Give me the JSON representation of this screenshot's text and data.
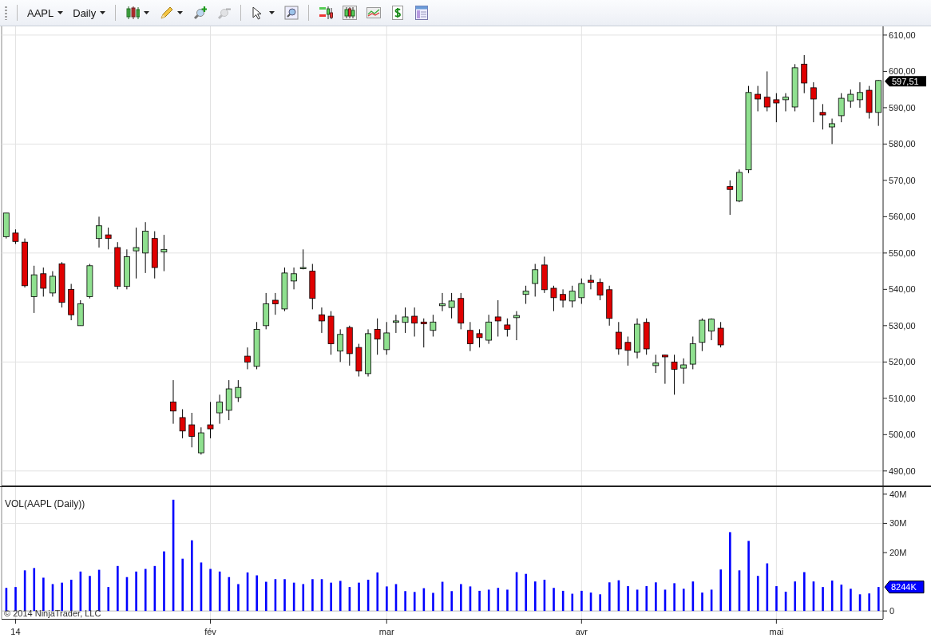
{
  "toolbar": {
    "instrument": "AAPL",
    "interval": "Daily",
    "tools": [
      {
        "kind": "bars",
        "disabled": false
      },
      {
        "kind": "pencil",
        "disabled": false
      },
      {
        "kind": "zoom-in",
        "disabled": false
      },
      {
        "kind": "zoom-out",
        "disabled": true
      },
      {
        "kind": "pointer",
        "disabled": false
      },
      {
        "kind": "zoom-box",
        "disabled": false
      },
      {
        "kind": "indicators",
        "disabled": false
      },
      {
        "kind": "strategy",
        "disabled": false
      },
      {
        "kind": "lines",
        "disabled": false
      },
      {
        "kind": "dollar",
        "disabled": false
      },
      {
        "kind": "properties",
        "disabled": false
      }
    ]
  },
  "price_pane": {
    "last_price_tag": "597,51",
    "chart_data": {
      "type": "candlestick",
      "grid": true,
      "ylim": [
        486,
        612.4
      ],
      "yticks": [
        {
          "value": 490,
          "label": "490,00"
        },
        {
          "value": 500,
          "label": "500,00"
        },
        {
          "value": 510,
          "label": "510,00"
        },
        {
          "value": 520,
          "label": "520,00"
        },
        {
          "value": 530,
          "label": "530,00"
        },
        {
          "value": 540,
          "label": "540,00"
        },
        {
          "value": 550,
          "label": "550,00"
        },
        {
          "value": 560,
          "label": "560,00"
        },
        {
          "value": 570,
          "label": "570,00"
        },
        {
          "value": 580,
          "label": "580,00"
        },
        {
          "value": 590,
          "label": "590,00"
        },
        {
          "value": 600,
          "label": "600,00"
        },
        {
          "value": 610,
          "label": "610,00"
        }
      ],
      "categories": [
        null,
        null,
        null,
        null,
        null,
        null,
        null,
        null,
        null,
        null,
        null,
        null,
        null,
        null,
        null,
        null,
        null,
        null,
        null,
        null,
        null,
        null,
        null,
        null,
        null,
        null,
        null,
        null,
        null,
        null,
        null,
        null,
        null,
        null,
        null,
        null,
        null,
        null,
        null,
        null,
        null,
        null,
        null,
        null,
        null,
        null,
        null,
        null,
        null,
        null,
        null,
        null,
        null,
        null,
        null,
        null,
        null,
        null,
        null,
        null,
        null,
        null,
        null,
        null,
        null,
        null,
        null,
        null,
        null,
        null,
        null,
        null,
        null,
        null,
        null,
        null,
        null,
        null,
        null,
        null,
        null,
        null,
        null,
        null,
        null,
        null,
        null,
        null,
        null,
        null,
        null,
        null,
        null,
        null,
        null
      ],
      "ohlc": [
        [
          554.5,
          561,
          554,
          561
        ],
        [
          555.5,
          556.5,
          552.5,
          553.2
        ],
        [
          553,
          554,
          540.5,
          541
        ],
        [
          538,
          546.5,
          533.5,
          544
        ],
        [
          544.3,
          546,
          538,
          540.3
        ],
        [
          539,
          545,
          538,
          543.6
        ],
        [
          547,
          547.5,
          535,
          536.4
        ],
        [
          540,
          541.5,
          531.5,
          533
        ],
        [
          530,
          537,
          530,
          536
        ],
        [
          538,
          547,
          537.5,
          546.5
        ],
        [
          554,
          560,
          551.5,
          557.5
        ],
        [
          555,
          557,
          551,
          554
        ],
        [
          551.5,
          553,
          540,
          540.8
        ],
        [
          540.8,
          551,
          540,
          549
        ],
        [
          550.6,
          557,
          543,
          551.5
        ],
        [
          550,
          558.5,
          544.5,
          556
        ],
        [
          554,
          556,
          543,
          546
        ],
        [
          550.3,
          555,
          545,
          551
        ],
        [
          509,
          515,
          503,
          506.5
        ],
        [
          504.7,
          507,
          499,
          501
        ],
        [
          502.7,
          506,
          496.5,
          499.5
        ],
        [
          495,
          502,
          494.5,
          500.5
        ],
        [
          502.7,
          509,
          499,
          501.6
        ],
        [
          506,
          511,
          503,
          509
        ],
        [
          506.7,
          515,
          504,
          512.6
        ],
        [
          510.2,
          515,
          509,
          513
        ],
        [
          521.6,
          524,
          518,
          520
        ],
        [
          518.8,
          531,
          518,
          529
        ],
        [
          530,
          539,
          529,
          536
        ],
        [
          537,
          539,
          533,
          536
        ],
        [
          534.6,
          546,
          534,
          544.5
        ],
        [
          542.3,
          546,
          540,
          544.3
        ],
        [
          545.8,
          551,
          545.5,
          546
        ],
        [
          545,
          547,
          534.5,
          537.5
        ],
        [
          533,
          535,
          528,
          531.3
        ],
        [
          532.6,
          534,
          522,
          525
        ],
        [
          523,
          529,
          520,
          527.6
        ],
        [
          529.5,
          530,
          519,
          522.3
        ],
        [
          524,
          525,
          516,
          517.5
        ],
        [
          516.8,
          529,
          516,
          527.8
        ],
        [
          529,
          532,
          522,
          526.3
        ],
        [
          523.4,
          531,
          522,
          528
        ],
        [
          530.9,
          533,
          528,
          531.3
        ],
        [
          530.9,
          535,
          528,
          532.4
        ],
        [
          532.6,
          535,
          527,
          530.7
        ],
        [
          531,
          532,
          524,
          530.5
        ],
        [
          528.7,
          533,
          527,
          531
        ],
        [
          535.5,
          539,
          534,
          536
        ],
        [
          535,
          539,
          532,
          536.8
        ],
        [
          537.5,
          539,
          529,
          530.7
        ],
        [
          528.7,
          531,
          523,
          525
        ],
        [
          527.8,
          529,
          524,
          526.7
        ],
        [
          526,
          533,
          525,
          531
        ],
        [
          532.4,
          537,
          527,
          531.3
        ],
        [
          530.2,
          532,
          527,
          529
        ],
        [
          532.2,
          534,
          526,
          532.8
        ],
        [
          538.6,
          541,
          536,
          539.5
        ],
        [
          541.6,
          547,
          538,
          545.4
        ],
        [
          546.7,
          549,
          539,
          539.9
        ],
        [
          540.3,
          541,
          534,
          537.7
        ],
        [
          538.6,
          540,
          535,
          537
        ],
        [
          536.8,
          541,
          535,
          539.5
        ],
        [
          537.7,
          543,
          536,
          541.6
        ],
        [
          542.5,
          544,
          540,
          541.9
        ],
        [
          541.9,
          543,
          537,
          538.4
        ],
        [
          539.9,
          541,
          530,
          532
        ],
        [
          528.2,
          531,
          522,
          523.6
        ],
        [
          525.4,
          527,
          519,
          523.2
        ],
        [
          522.7,
          532,
          521,
          530.4
        ],
        [
          530.9,
          532,
          522,
          523.6
        ],
        [
          519,
          522,
          517,
          519.7
        ],
        [
          521.9,
          522,
          514,
          521.4
        ],
        [
          520,
          522,
          511,
          518
        ],
        [
          518.3,
          521,
          514,
          519.2
        ],
        [
          519.4,
          527,
          518,
          525
        ],
        [
          525.4,
          532,
          523,
          531.5
        ],
        [
          528.5,
          532,
          526,
          531.8
        ],
        [
          529.3,
          531,
          524,
          524.7
        ],
        [
          568.3,
          570,
          560.5,
          567.5
        ],
        [
          564.3,
          573,
          564,
          572.2
        ],
        [
          572.9,
          596,
          572,
          594.2
        ],
        [
          593.7,
          596,
          589,
          592.4
        ],
        [
          592.9,
          600,
          589,
          590.2
        ],
        [
          592.2,
          594,
          586,
          591.3
        ],
        [
          592.2,
          594,
          589,
          592.9
        ],
        [
          590.2,
          602,
          589,
          601
        ],
        [
          602,
          604.5,
          594,
          596.8
        ],
        [
          595.5,
          597,
          586,
          592.4
        ],
        [
          588.7,
          591,
          584,
          588
        ],
        [
          584.7,
          587,
          580,
          585.6
        ],
        [
          587.8,
          594,
          586,
          592.6
        ],
        [
          591.8,
          595,
          590,
          593.7
        ],
        [
          592.2,
          597,
          590,
          594.2
        ],
        [
          594.8,
          596,
          587,
          588.7
        ],
        [
          588.7,
          597.6,
          585,
          597.5
        ]
      ]
    }
  },
  "volume_pane": {
    "title": "VOL(AAPL (Daily))",
    "last_volume_tag": "8244K",
    "copyright": "© 2014 NinjaTrader, LLC",
    "chart_data": {
      "type": "bar",
      "grid": true,
      "ylim": [
        -2.7,
        42.7
      ],
      "yticks": [
        {
          "value": 0,
          "label": "0"
        },
        {
          "value": 20,
          "label": "20M"
        },
        {
          "value": 30,
          "label": "30M"
        },
        {
          "value": 40,
          "label": "40M"
        }
      ],
      "categories": [
        null,
        "14",
        null,
        null,
        null,
        null,
        null,
        null,
        null,
        null,
        null,
        null,
        null,
        null,
        null,
        null,
        null,
        null,
        null,
        null,
        null,
        null,
        "fév",
        null,
        null,
        null,
        null,
        null,
        null,
        null,
        null,
        null,
        null,
        null,
        null,
        null,
        null,
        null,
        null,
        null,
        null,
        "mar",
        null,
        null,
        null,
        null,
        null,
        null,
        null,
        null,
        null,
        null,
        null,
        null,
        null,
        null,
        null,
        null,
        null,
        null,
        null,
        null,
        "avr",
        null,
        null,
        null,
        null,
        null,
        null,
        null,
        null,
        null,
        null,
        null,
        null,
        null,
        null,
        null,
        null,
        null,
        null,
        null,
        null,
        "mai",
        null,
        null,
        null,
        null,
        null,
        null,
        null,
        null,
        null,
        null,
        null
      ],
      "series": [
        {
          "color": "#0000ff",
          "values": [
            7.9,
            8.2,
            13.9,
            14.7,
            11.4,
            9.2,
            9.7,
            10.7,
            13.5,
            12,
            14.1,
            8.2,
            15.4,
            11.6,
            13.5,
            14.4,
            15.4,
            20.4,
            38.1,
            17.9,
            24.2,
            16.6,
            14.4,
            13.5,
            11.6,
            9.2,
            13.2,
            12.2,
            10,
            10.9,
            10.9,
            9.7,
            9.2,
            10.9,
            10.9,
            9.7,
            10.3,
            8.2,
            9.7,
            10.7,
            13.2,
            8.4,
            9.2,
            6.8,
            6.5,
            7.8,
            6.2,
            10,
            6.8,
            9.2,
            8.4,
            6.9,
            7.3,
            7.9,
            7.3,
            13.3,
            12.7,
            10.1,
            10.7,
            7.9,
            6.9,
            5.9,
            6.9,
            6.3,
            5.7,
            9.8,
            10.5,
            8.5,
            7.3,
            8.5,
            9.8,
            7.3,
            9.5,
            7.6,
            10.1,
            6.3,
            7.3,
            14.2,
            27,
            13.9,
            24,
            12,
            16.3,
            8.5,
            6.6,
            10.1,
            13.3,
            10.1,
            8.2,
            10.4,
            9.0,
            7.6,
            5.7,
            6,
            8.2
          ]
        }
      ]
    }
  }
}
